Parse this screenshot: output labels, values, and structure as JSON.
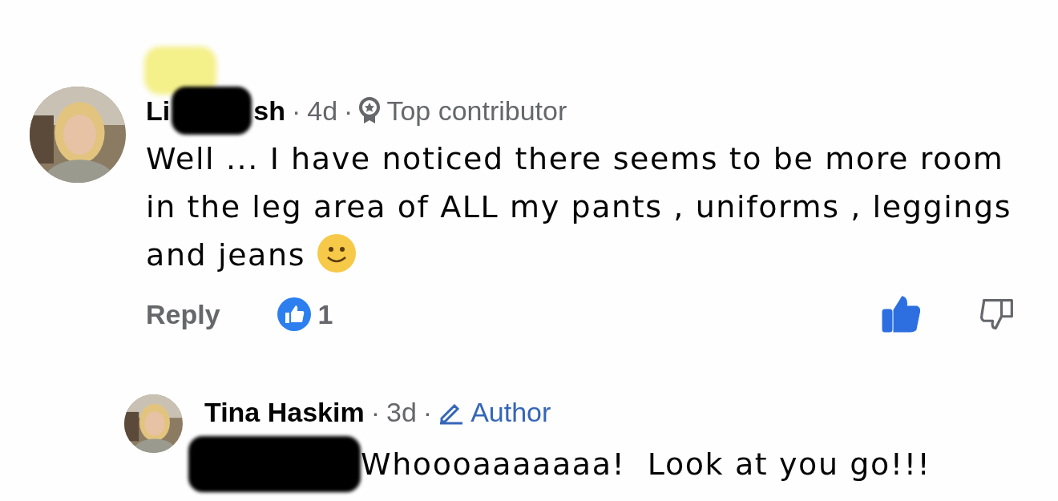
{
  "comments": [
    {
      "name_parts": [
        "Li",
        "sh"
      ],
      "name_redacted": true,
      "separators": [
        "·",
        "·"
      ],
      "time": "4d",
      "badge": {
        "kind": "contributor",
        "label": "Top contributor"
      },
      "text": "Well ... I have noticed there seems to be more room in the leg area of ALL my pants , uniforms , leggings and jeans",
      "emoji": {
        "kind": "smile"
      },
      "reply_label": "Reply",
      "like_count": "1",
      "liked": true,
      "disliked": false,
      "replies": [
        {
          "name": "Tina Haskim",
          "separators": [
            "·",
            "·"
          ],
          "time": "3d",
          "badge": {
            "kind": "author",
            "label": "Author"
          },
          "mention_redacted": true,
          "text": "Whoooaaaaaaa!  Look at you go!!!"
        }
      ]
    }
  ]
}
